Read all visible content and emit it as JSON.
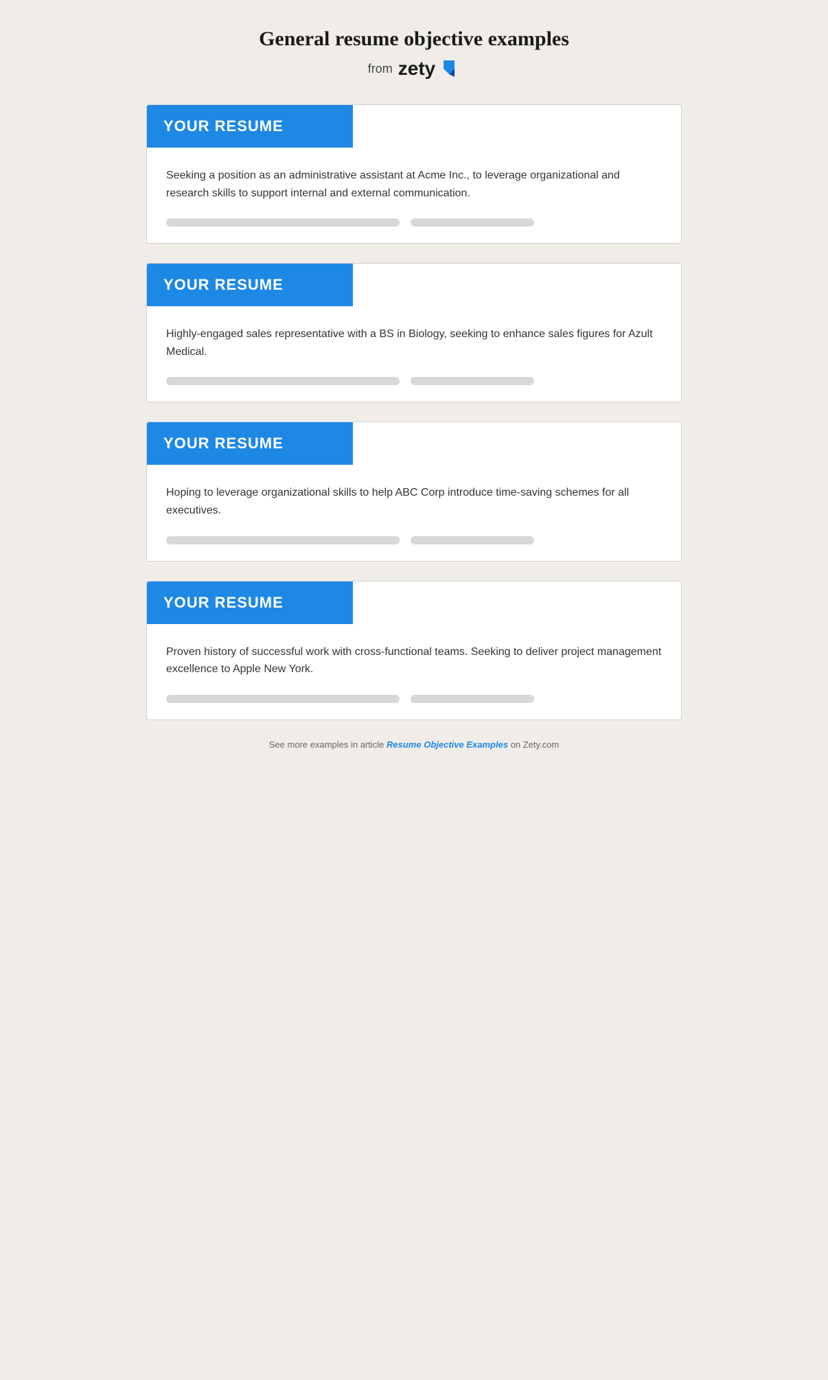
{
  "page": {
    "title": "General resume objective examples",
    "brand_from": "from",
    "brand_name": "zety"
  },
  "cards": [
    {
      "header": "YOUR RESUME",
      "objective": "Seeking a position as an administrative assistant at Acme Inc., to leverage organizational and research skills to support internal and external communication."
    },
    {
      "header": "YOUR RESUME",
      "objective": "Highly-engaged sales representative with a BS in Biology, seeking to enhance sales figures for Azult Medical."
    },
    {
      "header": "YOUR RESUME",
      "objective": "Hoping to leverage organizational skills to help ABC Corp introduce time-saving schemes for all executives."
    },
    {
      "header": "YOUR RESUME",
      "objective": "Proven history of successful work with cross-functional teams. Seeking to deliver project management excellence to Apple New York."
    }
  ],
  "footer": {
    "text_before": "See more examples in article ",
    "link_text": "Resume Objective Examples",
    "text_after": " on Zety.com"
  }
}
